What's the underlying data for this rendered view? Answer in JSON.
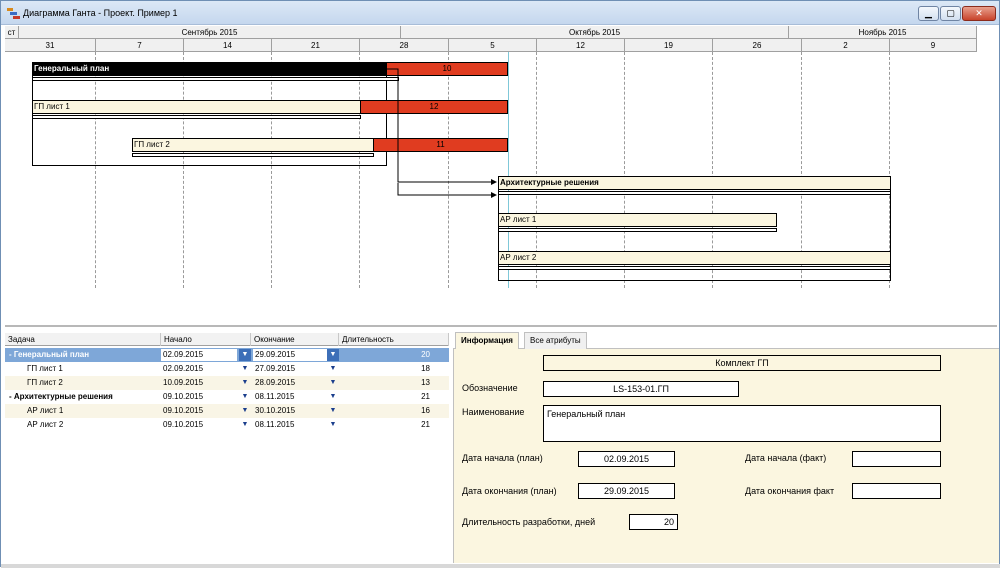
{
  "window": {
    "title": "Диаграмма Ганта - Проект. Пример 1"
  },
  "timeline": {
    "corner_label": "ст",
    "months": [
      "Сентябрь 2015",
      "Октябрь 2015",
      "Ноябрь 2015"
    ],
    "days": [
      "31",
      "7",
      "14",
      "21",
      "28",
      "5",
      "12",
      "19",
      "26",
      "2",
      "9"
    ]
  },
  "gantt": {
    "general_plan_label": "Генеральный план",
    "general_plan_slack": "10",
    "gp1_label": "ГП лист 1",
    "gp1_slack": "12",
    "gp2_label": "ГП лист 2",
    "gp2_slack": "11",
    "ar_label": "Архитектурные решения",
    "ar1_label": "АР лист 1",
    "ar2_label": "АР лист 2",
    "slack_color": "#e03c20",
    "task_color": "#fbf6e0"
  },
  "grid": {
    "headers": {
      "task": "Задача",
      "start": "Начало",
      "end": "Окончание",
      "duration": "Длительность"
    },
    "rows": [
      {
        "name": "- Генеральный план",
        "start": "02.09.2015",
        "end": "29.09.2015",
        "duration": "20"
      },
      {
        "name": "ГП лист 1",
        "start": "02.09.2015",
        "end": "27.09.2015",
        "duration": "18"
      },
      {
        "name": "ГП лист 2",
        "start": "10.09.2015",
        "end": "28.09.2015",
        "duration": "13"
      },
      {
        "name": "- Архитектурные решения",
        "start": "09.10.2015",
        "end": "08.11.2015",
        "duration": "21"
      },
      {
        "name": "АР лист 1",
        "start": "09.10.2015",
        "end": "30.10.2015",
        "duration": "16"
      },
      {
        "name": "АР лист 2",
        "start": "09.10.2015",
        "end": "08.11.2015",
        "duration": "21"
      }
    ],
    "dropdown_glyph": "▼"
  },
  "info": {
    "tabs": [
      "Информация",
      "Все атрибуты"
    ],
    "set_label": "Комплект ГП",
    "designation_label": "Обозначение",
    "designation_value": "LS-153-01.ГП",
    "name_label": "Наименование",
    "name_value": "Генеральный план",
    "start_plan_label": "Дата начала (план)",
    "start_plan_value": "02.09.2015",
    "end_plan_label": "Дата окончания (план)",
    "end_plan_value": "29.09.2015",
    "start_fact_label": "Дата начала (факт)",
    "start_fact_value": "",
    "end_fact_label": "Дата окончания факт",
    "end_fact_value": "",
    "duration_label": "Длительность разработки, дней",
    "duration_value": "20"
  }
}
